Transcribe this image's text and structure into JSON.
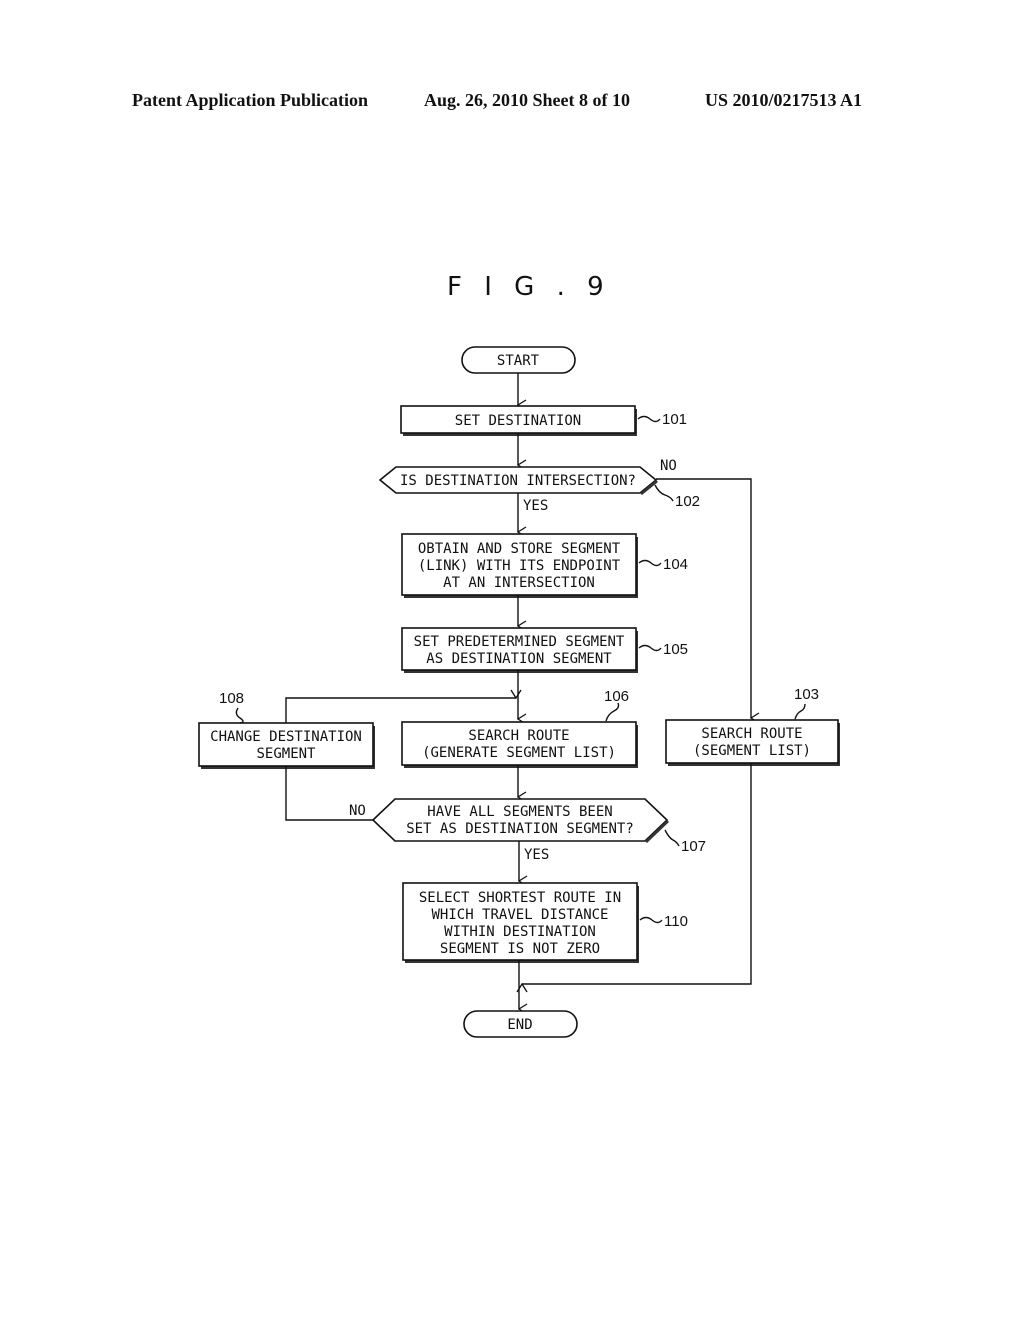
{
  "header": {
    "publication": "Patent Application Publication",
    "date_sheet": "Aug. 26, 2010  Sheet 8 of 10",
    "number": "US 2010/0217513 A1"
  },
  "figure": {
    "title": "F I G . 9"
  },
  "flowchart": {
    "start": "START",
    "end": "END",
    "s101": {
      "ref": "101",
      "lines": [
        "SET DESTINATION"
      ]
    },
    "s102": {
      "ref": "102",
      "lines": [
        "IS DESTINATION INTERSECTION?"
      ],
      "yes": "YES",
      "no": "NO"
    },
    "s103": {
      "ref": "103",
      "lines": [
        "SEARCH ROUTE",
        "(SEGMENT LIST)"
      ]
    },
    "s104": {
      "ref": "104",
      "lines": [
        "OBTAIN AND STORE SEGMENT",
        "(LINK) WITH ITS ENDPOINT",
        "AT AN INTERSECTION"
      ]
    },
    "s105": {
      "ref": "105",
      "lines": [
        "SET PREDETERMINED SEGMENT",
        "AS DESTINATION SEGMENT"
      ]
    },
    "s106": {
      "ref": "106",
      "lines": [
        "SEARCH ROUTE",
        "(GENERATE SEGMENT LIST)"
      ]
    },
    "s107": {
      "ref": "107",
      "lines": [
        "HAVE ALL SEGMENTS BEEN",
        "SET AS DESTINATION SEGMENT?"
      ],
      "yes": "YES",
      "no": "NO"
    },
    "s108": {
      "ref": "108",
      "lines": [
        "CHANGE DESTINATION",
        "SEGMENT"
      ]
    },
    "s110": {
      "ref": "110",
      "lines": [
        "SELECT SHORTEST ROUTE IN",
        "WHICH TRAVEL DISTANCE",
        "WITHIN DESTINATION",
        "SEGMENT IS NOT ZERO"
      ]
    }
  }
}
